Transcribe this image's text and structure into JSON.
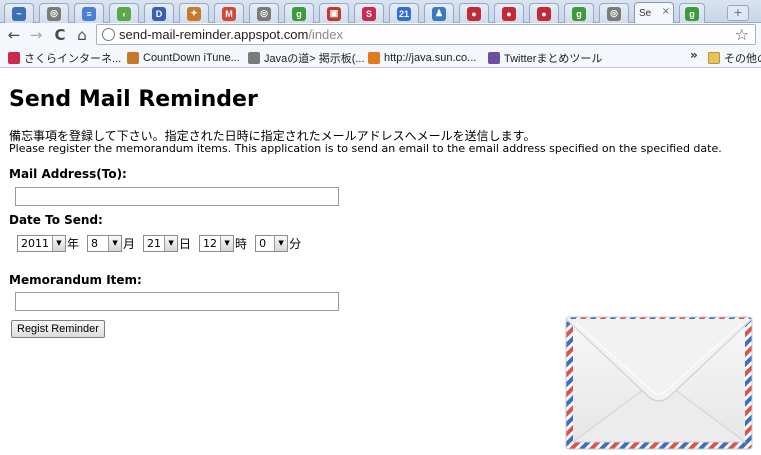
{
  "browser": {
    "active_tab_title": "Se",
    "tab_close_glyph": "×",
    "new_tab_glyph": "+",
    "tabs": [
      {
        "icon": "chart-icon",
        "color": "#3b6fb6",
        "glyph": "~"
      },
      {
        "icon": "globe-icon",
        "color": "#7b7b7b",
        "glyph": "◎"
      },
      {
        "icon": "document-icon",
        "color": "#4a7fd1",
        "glyph": "≡"
      },
      {
        "icon": "tag-icon",
        "color": "#5ba84a",
        "glyph": "‹"
      },
      {
        "icon": "d-icon",
        "color": "#3a5fb5",
        "glyph": "D"
      },
      {
        "icon": "mascot-icon",
        "color": "#c8782a",
        "glyph": "✦"
      },
      {
        "icon": "gmail-icon",
        "color": "#d34836",
        "glyph": "M"
      },
      {
        "icon": "globe-icon",
        "color": "#7b7b7b",
        "glyph": "◎"
      },
      {
        "icon": "google-icon",
        "color": "#3d9b3b",
        "glyph": "g"
      },
      {
        "icon": "red-square-icon",
        "color": "#c0392b",
        "glyph": "▣"
      },
      {
        "icon": "sakura-icon",
        "color": "#cc2a4a",
        "glyph": "S"
      },
      {
        "icon": "calendar-icon",
        "color": "#2f6fd6",
        "glyph": "21"
      },
      {
        "icon": "people-icon",
        "color": "#3a7bbf",
        "glyph": "♟"
      },
      {
        "icon": "red-circle-icon",
        "color": "#c22b36",
        "glyph": "●"
      },
      {
        "icon": "red-circle-icon",
        "color": "#c22b36",
        "glyph": "●"
      },
      {
        "icon": "red-circle-icon",
        "color": "#c22b36",
        "glyph": "●"
      },
      {
        "icon": "google-icon",
        "color": "#3d9b3b",
        "glyph": "g"
      },
      {
        "icon": "globe-icon",
        "color": "#7b7b7b",
        "glyph": "◎"
      }
    ],
    "trailing_tab_icon": {
      "icon": "google-icon",
      "color": "#3d9b3b",
      "glyph": "g"
    },
    "nav": {
      "back": "←",
      "forward": "→",
      "reload": "C",
      "home": "⌂"
    },
    "url_host": "send-mail-reminder.appspot.com",
    "url_path": "/index",
    "star_glyph": "☆",
    "bookmarks": [
      {
        "label": "さくらインターネ...",
        "icon": "sakura-icon",
        "color": "#cc2a4a"
      },
      {
        "label": "CountDown iTune...",
        "icon": "mascot-icon",
        "color": "#c8782a"
      },
      {
        "label": "Javaの道> 掲示板(...",
        "icon": "globe-icon",
        "color": "#7b7b7b"
      },
      {
        "label": "http://java.sun.co...",
        "icon": "java-icon",
        "color": "#e07a20"
      },
      {
        "label": "Twitterまとめツール",
        "icon": "owl-icon",
        "color": "#6b4fa0"
      }
    ],
    "bookmarks_overflow": "»",
    "other_bookmarks": "その他の"
  },
  "page": {
    "title": "Send Mail Reminder",
    "description_ja": "備忘事項を登録して下さい。指定された日時に指定されたメールアドレスへメールを送信します。",
    "description_en": "Please register the memorandum items. This application is to send an email to the email address specified on the specified date.",
    "mail_label": "Mail Address(To):",
    "mail_value": "",
    "date_label": "Date To Send:",
    "date": {
      "year": "2011",
      "year_unit": "年",
      "month": "8",
      "month_unit": "月",
      "day": "21",
      "day_unit": "日",
      "hour": "12",
      "hour_unit": "時",
      "minute": "0",
      "minute_unit": "分"
    },
    "dropdown_glyph": "▼",
    "memo_label": "Memorandum Item:",
    "memo_value": "",
    "submit_label": "Regist Reminder"
  },
  "colors": {
    "airmail_red": "#d9534f",
    "airmail_blue": "#3a6fc4"
  }
}
